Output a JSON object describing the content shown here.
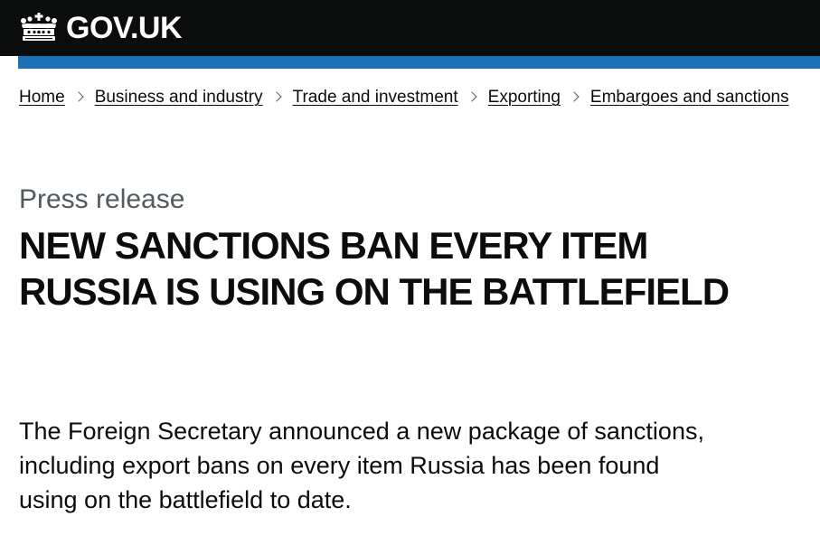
{
  "header": {
    "logo_text": "GOV.UK",
    "logo_icon": "crown-icon",
    "background": "#0b0c0c",
    "accent_bar_color": "#1d70b8"
  },
  "breadcrumbs": [
    {
      "label": "Home"
    },
    {
      "label": "Business and industry"
    },
    {
      "label": "Trade and investment"
    },
    {
      "label": "Exporting"
    },
    {
      "label": "Embargoes and sanctions"
    }
  ],
  "separator_icon": "chevron-right-icon",
  "main": {
    "caption": "Press release",
    "title": "NEW SANCTIONS BAN EVERY ITEM RUSSIA IS USING ON THE BATTLEFIELD",
    "lead": "The Foreign Secretary announced a new package of sanctions, including export bans on every item Russia has been found using on the battlefield to date."
  }
}
